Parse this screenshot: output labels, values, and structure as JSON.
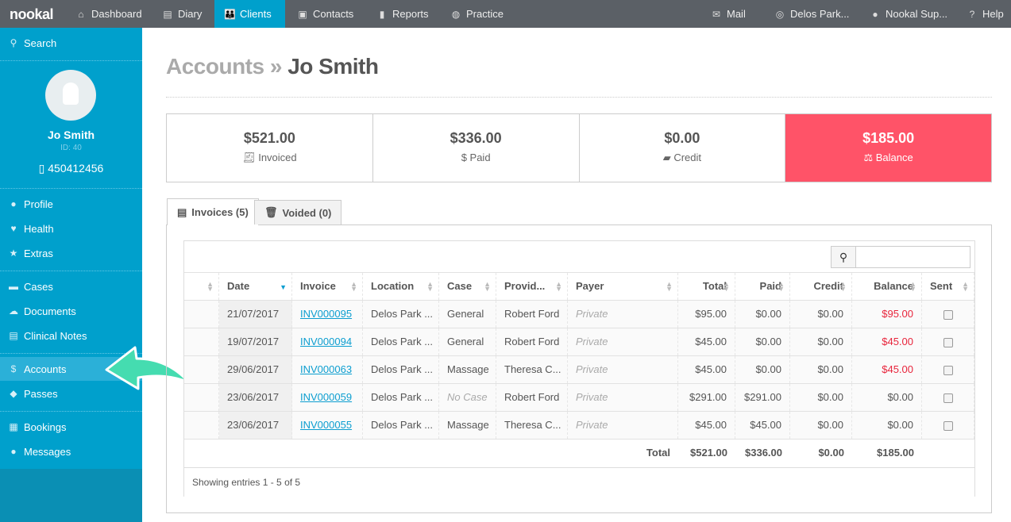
{
  "topbar": {
    "logo": "nookal",
    "nav": [
      {
        "label": "Dashboard",
        "icon": "home-icon"
      },
      {
        "label": "Diary",
        "icon": "diary-icon"
      },
      {
        "label": "Clients",
        "icon": "clients-icon",
        "active": true
      },
      {
        "label": "Contacts",
        "icon": "contacts-icon"
      },
      {
        "label": "Reports",
        "icon": "reports-icon"
      },
      {
        "label": "Practice",
        "icon": "globe-icon"
      }
    ],
    "right": [
      {
        "label": "Mail",
        "icon": "mail-icon"
      },
      {
        "label": "Delos Park...",
        "icon": "compass-icon"
      },
      {
        "label": "Nookal Sup...",
        "icon": "user-icon"
      },
      {
        "label": "Help",
        "icon": "help-icon"
      }
    ]
  },
  "sidebar": {
    "search": "Search",
    "client": {
      "name": "Jo Smith",
      "id": "ID: 40",
      "phone": "450412456"
    },
    "items": [
      {
        "label": "Profile",
        "icon": "user-icon"
      },
      {
        "label": "Health",
        "icon": "heart-icon"
      },
      {
        "label": "Extras",
        "icon": "star-icon"
      },
      {
        "label": "Cases",
        "icon": "folder-icon"
      },
      {
        "label": "Documents",
        "icon": "cloud-icon"
      },
      {
        "label": "Clinical Notes",
        "icon": "note-icon"
      },
      {
        "label": "Accounts",
        "icon": "dollar-icon",
        "selected": true
      },
      {
        "label": "Passes",
        "icon": "ticket-icon"
      },
      {
        "label": "Bookings",
        "icon": "calendar-icon"
      },
      {
        "label": "Messages",
        "icon": "chat-icon"
      }
    ]
  },
  "page": {
    "title_prefix": "Accounts »",
    "title_name": "Jo Smith"
  },
  "summary": [
    {
      "value": "$521.00",
      "label": "Invoiced"
    },
    {
      "value": "$336.00",
      "label": "Paid"
    },
    {
      "value": "$0.00",
      "label": "Credit"
    },
    {
      "value": "$185.00",
      "label": "Balance"
    }
  ],
  "tabs": [
    {
      "label": "Invoices (5)"
    },
    {
      "label": "Voided (0)"
    }
  ],
  "table": {
    "search_value": "",
    "headers": [
      "",
      "Date",
      "Invoice",
      "Location",
      "Case",
      "Provid...",
      "Payer",
      "Total",
      "Paid",
      "Credit",
      "Balance",
      "Sent"
    ],
    "rows": [
      [
        "21/07/2017",
        "INV000095",
        "Delos Park ...",
        "General",
        "Robert Ford",
        "Private",
        "$95.00",
        "$0.00",
        "$0.00",
        "$95.00"
      ],
      [
        "19/07/2017",
        "INV000094",
        "Delos Park ...",
        "General",
        "Robert Ford",
        "Private",
        "$45.00",
        "$0.00",
        "$0.00",
        "$45.00"
      ],
      [
        "29/06/2017",
        "INV000063",
        "Delos Park ...",
        "Massage",
        "Theresa C...",
        "Private",
        "$45.00",
        "$0.00",
        "$0.00",
        "$45.00"
      ],
      [
        "23/06/2017",
        "INV000059",
        "Delos Park ...",
        "No Case",
        "Robert Ford",
        "Private",
        "$291.00",
        "$291.00",
        "$0.00",
        "$0.00"
      ],
      [
        "23/06/2017",
        "INV000055",
        "Delos Park ...",
        "Massage",
        "Theresa C...",
        "Private",
        "$45.00",
        "$45.00",
        "$0.00",
        "$0.00"
      ]
    ],
    "totals": {
      "label": "Total",
      "total": "$521.00",
      "paid": "$336.00",
      "credit": "$0.00",
      "balance": "$185.00"
    },
    "footer": "Showing entries 1 - 5 of 5"
  },
  "colors": {
    "brand": "#00a0cc",
    "balance": "#ff5368",
    "arrow": "#45dcb0"
  }
}
